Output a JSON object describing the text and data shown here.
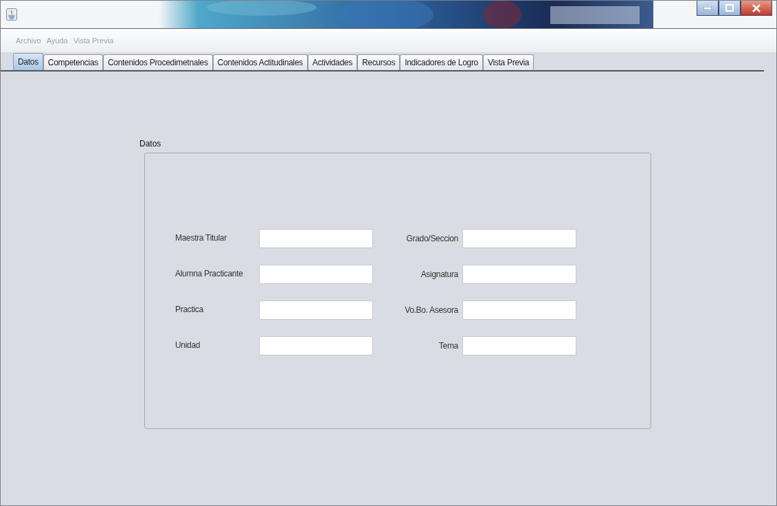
{
  "menu": [
    "Archivo",
    "Ayuda",
    "Vista Previa"
  ],
  "tabs": [
    {
      "label": "Datos",
      "selected": true
    },
    {
      "label": "Competencias",
      "selected": false
    },
    {
      "label": "Contenidos Procedimetnales",
      "selected": false
    },
    {
      "label": "Contenidos Actitudinales",
      "selected": false
    },
    {
      "label": "Actividades",
      "selected": false
    },
    {
      "label": "Recursos",
      "selected": false
    },
    {
      "label": "Indicadores de Logro",
      "selected": false
    },
    {
      "label": "Vista Previa",
      "selected": false
    }
  ],
  "panel": {
    "title": "Datos",
    "rows": [
      {
        "left": {
          "label": "Maestra Titular"
        },
        "right": {
          "label": "Grado/Seccion"
        }
      },
      {
        "left": {
          "label": "Alumna Practicante"
        },
        "right": {
          "label": "Asignatura"
        }
      },
      {
        "left": {
          "label": "Practica"
        },
        "right": {
          "label": "Vo.Bo. Asesora"
        }
      },
      {
        "left": {
          "label": "Unidad"
        },
        "right": {
          "label": "Tema"
        }
      }
    ]
  }
}
